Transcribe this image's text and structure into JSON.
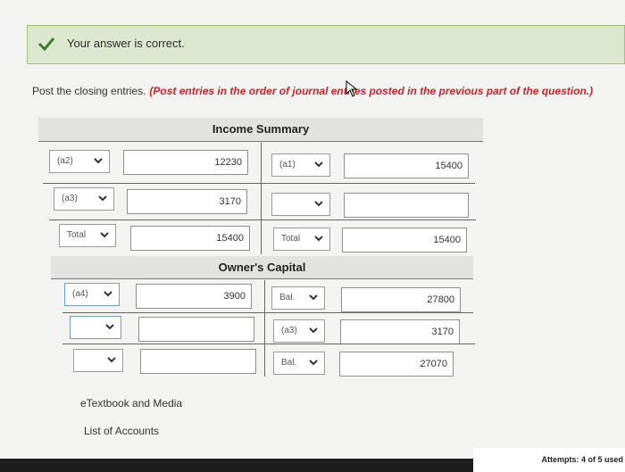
{
  "banner": {
    "message": "Your answer is correct.",
    "icon": "check-icon"
  },
  "instructions": {
    "text": "Post the closing entries.",
    "hint": "(Post entries in the order of journal entries posted in the previous part of the question.)"
  },
  "income_summary": {
    "title": "Income Summary",
    "rows": [
      {
        "left_sel": "(a2)",
        "left_val": "12230",
        "right_sel": "(a1)",
        "right_val": "15400"
      },
      {
        "left_sel": "(a3)",
        "left_val": "3170",
        "right_sel": "",
        "right_val": ""
      },
      {
        "left_sel": "Total",
        "left_val": "15400",
        "right_sel": "Total",
        "right_val": "15400"
      }
    ]
  },
  "owners_capital": {
    "title": "Owner's Capital",
    "rows": [
      {
        "left_sel": "(a4)",
        "left_val": "3900",
        "right_sel": "Bal.",
        "right_val": "27800"
      },
      {
        "left_sel": "",
        "left_val": "",
        "right_sel": "(a3)",
        "right_val": "3170"
      },
      {
        "left_sel": "",
        "left_val": "",
        "right_sel": "Bal.",
        "right_val": "27070"
      }
    ]
  },
  "links": {
    "etextbook": "eTextbook and Media",
    "list_of_accounts": "List of Accounts"
  },
  "attempts": "Attempts: 4 of 5 used",
  "colors": {
    "banner_bg": "#dde7cf",
    "banner_border": "#9fbf7c",
    "hint_red": "#c8272d",
    "check_green": "#3d7a2a"
  }
}
